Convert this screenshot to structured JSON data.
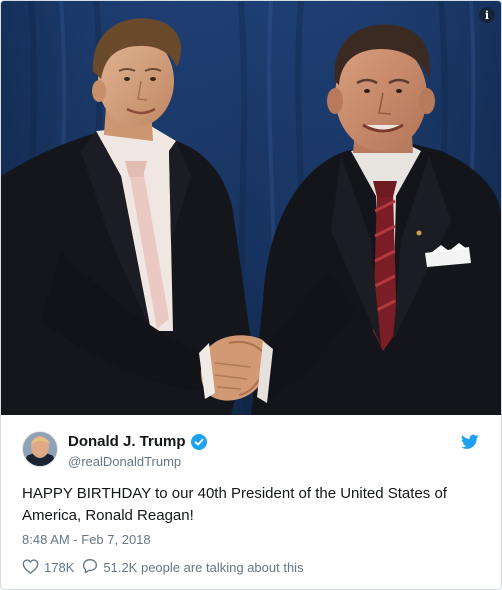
{
  "tweet": {
    "display_name": "Donald J. Trump",
    "handle": "@realDonaldTrump",
    "text": "HAPPY BIRTHDAY to our 40th President of the United States of America, Ronald Reagan!",
    "timestamp": "8:48 AM - Feb 7, 2018",
    "likes_count": "178K",
    "talking_text": "51.2K people are talking about this"
  },
  "icons": {
    "info": "info-icon",
    "verified": "verified-badge-icon",
    "twitter": "twitter-bird-icon",
    "like": "heart-icon",
    "reply": "speech-bubble-icon"
  },
  "colors": {
    "accent": "#1da1f2",
    "text_primary": "#14171a",
    "text_secondary": "#657786",
    "border": "#d6dde3"
  }
}
